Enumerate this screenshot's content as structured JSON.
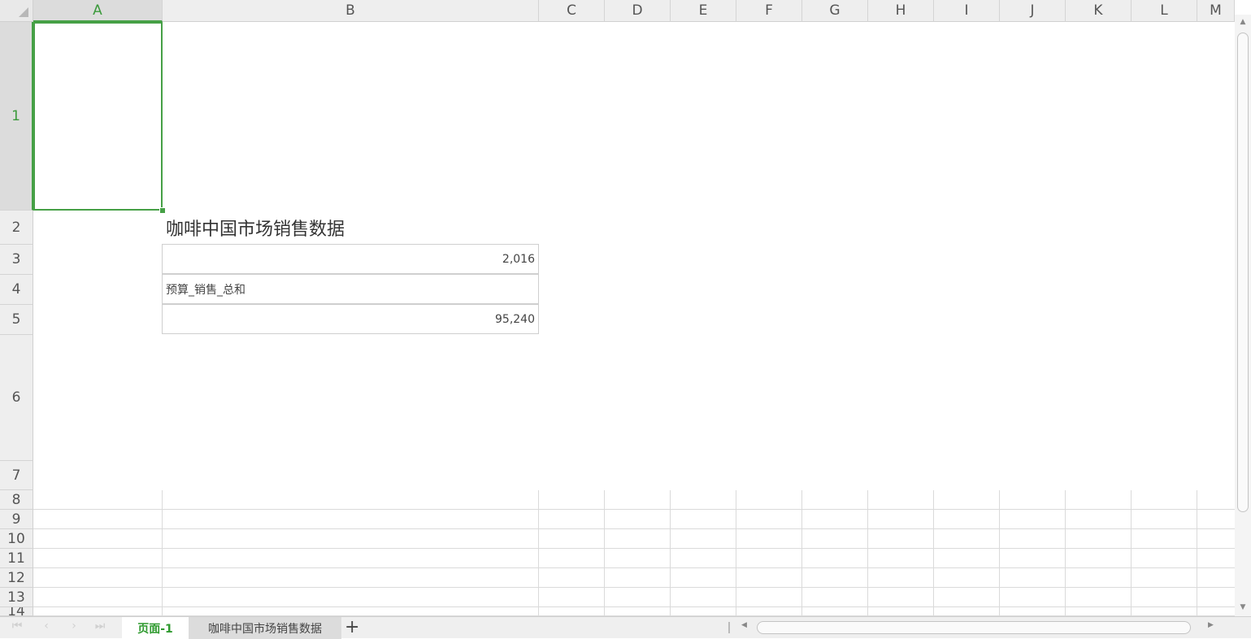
{
  "columns": [
    {
      "label": "A",
      "selected": true
    },
    {
      "label": "B"
    },
    {
      "label": "C"
    },
    {
      "label": "D"
    },
    {
      "label": "E"
    },
    {
      "label": "F"
    },
    {
      "label": "G"
    },
    {
      "label": "H"
    },
    {
      "label": "I"
    },
    {
      "label": "J"
    },
    {
      "label": "K"
    },
    {
      "label": "L"
    },
    {
      "label": "M"
    }
  ],
  "rows": [
    {
      "label": "1",
      "selected": true
    },
    {
      "label": "2"
    },
    {
      "label": "3"
    },
    {
      "label": "4"
    },
    {
      "label": "5"
    },
    {
      "label": "6"
    },
    {
      "label": "7"
    },
    {
      "label": "8"
    },
    {
      "label": "9"
    },
    {
      "label": "10"
    },
    {
      "label": "11"
    },
    {
      "label": "12"
    },
    {
      "label": "13"
    },
    {
      "label": "14"
    }
  ],
  "content": {
    "title": "咖啡中国市场销售数据",
    "year_value": "2,016",
    "measure_label": "预算_销售_总和",
    "total_value": "95,240"
  },
  "sheet_tabs": {
    "active": "页面-1",
    "other": "咖啡中国市场销售数据",
    "add_label": "+"
  },
  "colors": {
    "accent": "#46a046",
    "header_bg": "#eeeeee",
    "grid": "#dadada"
  }
}
